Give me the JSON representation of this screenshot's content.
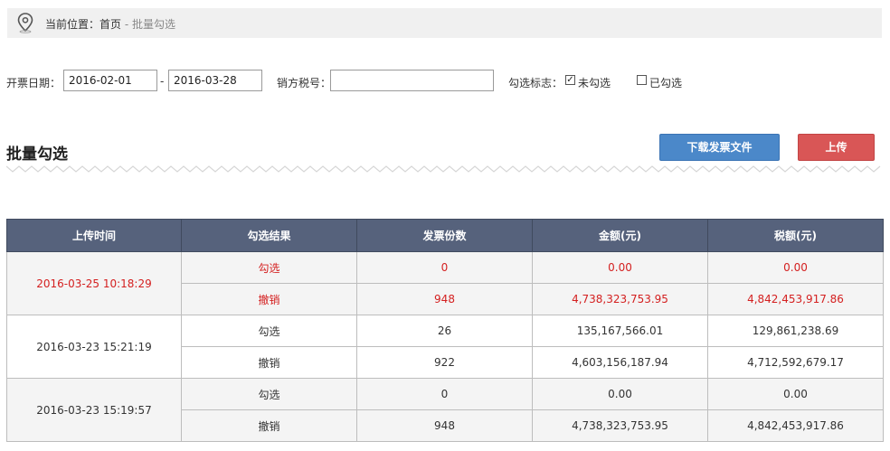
{
  "breadcrumb": {
    "prefix": "当前位置：",
    "home": "首页",
    "separator": " - ",
    "current": "批量勾选",
    "icon": "location-pin-icon"
  },
  "filters": {
    "date_label": "开票日期：",
    "date_from": "2016-02-01",
    "date_dash": "-",
    "date_to": "2016-03-28",
    "seller_tax_label": "销方税号：",
    "seller_tax_value": "",
    "check_flag_label": "勾选标志：",
    "unchecked_label": "未勾选",
    "unchecked_checked": true,
    "checked_label": "已勾选",
    "checked_checked": false
  },
  "section": {
    "title": "批量勾选"
  },
  "buttons": {
    "download_label": "下载发票文件",
    "upload_label": "上传"
  },
  "colors": {
    "header_bg": "#56627c",
    "highlight_text": "#d42020",
    "download_btn": "#4b88c9",
    "upload_btn": "#d95656"
  },
  "table": {
    "headers": [
      "上传时间",
      "勾选结果",
      "发票份数",
      "金额(元)",
      "税额(元)"
    ],
    "groups": [
      {
        "time": "2016-03-25 10:18:29",
        "rows": [
          {
            "result": "勾选",
            "count": "0",
            "amount": "0.00",
            "tax": "0.00"
          },
          {
            "result": "撤销",
            "count": "948",
            "amount": "4,738,323,753.95",
            "tax": "4,842,453,917.86"
          }
        ]
      },
      {
        "time": "2016-03-23 15:21:19",
        "rows": [
          {
            "result": "勾选",
            "count": "26",
            "amount": "135,167,566.01",
            "tax": "129,861,238.69"
          },
          {
            "result": "撤销",
            "count": "922",
            "amount": "4,603,156,187.94",
            "tax": "4,712,592,679.17"
          }
        ]
      },
      {
        "time": "2016-03-23 15:19:57",
        "rows": [
          {
            "result": "勾选",
            "count": "0",
            "amount": "0.00",
            "tax": "0.00"
          },
          {
            "result": "撤销",
            "count": "948",
            "amount": "4,738,323,753.95",
            "tax": "4,842,453,917.86"
          }
        ]
      }
    ]
  }
}
